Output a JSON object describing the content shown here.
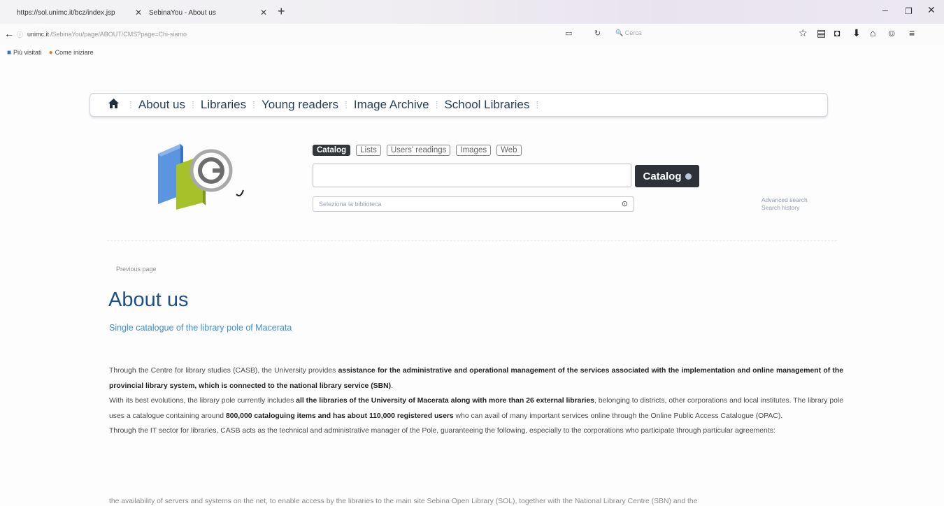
{
  "browser": {
    "tabs": [
      {
        "label": "https://sol.unimc.it/bcz/index.jsp",
        "active": false
      },
      {
        "label": "SebinaYou - About us",
        "active": true
      }
    ],
    "url_domain": "unimc.it",
    "url_path": "/SebinaYou/page/ABOUT/CMS?page=Chi-siamo",
    "search_placeholder": "Cerca",
    "bookmarks": [
      {
        "label": "Più visitati",
        "icon": "bookmark-icon"
      },
      {
        "label": "Come iniziare",
        "icon": "firefox-icon"
      }
    ]
  },
  "nav": {
    "items": [
      "About us",
      "Libraries",
      "Young readers",
      "Image Archive",
      "School Libraries"
    ]
  },
  "search": {
    "tabs": [
      "Catalog",
      "Lists",
      "Users' readings",
      "Images",
      "Web"
    ],
    "active_tab": "Catalog",
    "button_label": "Catalog",
    "library_placeholder": "Seleziona la biblioteca",
    "advanced_search": "Advanced search",
    "search_history": "Search history"
  },
  "page": {
    "previous_page": "Previous page",
    "title": "About us",
    "subtitle": "Single catalogue of the library pole of Macerata",
    "p1_a": "Through the Centre for library studies (CASB), the University provides ",
    "p1_b": "assistance for the administrative and operational management of the services associated with the implementation and online management of the provincial library system, which is connected to the national library service (SBN)",
    "p1_c": ".",
    "p2_a": "With its best evolutions, the library pole currently includes ",
    "p2_b": "all the libraries of the University of Macerata along with more than 26 external libraries",
    "p2_c": ", belonging to districts, other corporations and local institutes. The library pole uses a catalogue containing around ",
    "p2_d": "800,000 cataloguing items and has about 110,000 registered users",
    "p2_e": " who can avail of many important services online through the Online Public Access Catalogue (OPAC).",
    "p3": "Through the IT sector for libraries, CASB acts as the technical and administrative manager of the Pole, guaranteeing the following, especially to the corporations who participate through particular agreements:",
    "p4_partial": "the availability of servers and systems on the net, to enable access by the libraries to the main site Sebina Open Library (SOL), together with the National Library Centre (SBN) and the"
  }
}
